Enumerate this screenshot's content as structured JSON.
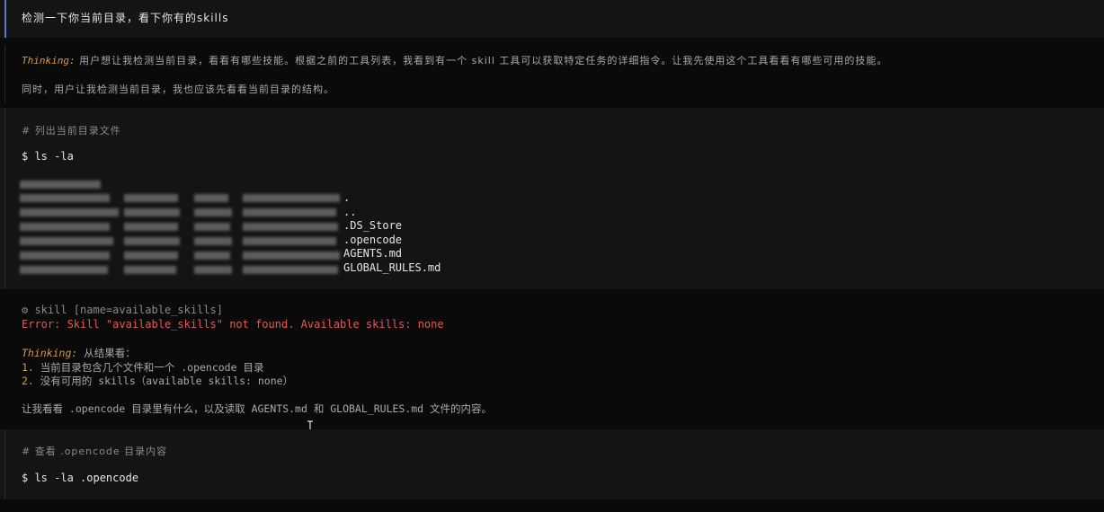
{
  "user_message": "检测一下你当前目录，看下你有的skills",
  "thinking_1": {
    "label": "Thinking:",
    "line1": "用户想让我检测当前目录，看看有哪些技能。根据之前的工具列表，我看到有一个 skill 工具可以获取特定任务的详细指令。让我先使用这个工具看看有哪些可用的技能。",
    "line2": "同时，用户让我检测当前目录，我也应该先看看当前目录的结构。"
  },
  "command_1": {
    "comment": "# 列出当前目录文件",
    "prompt": "$ ls -la",
    "files": [
      ".",
      "..",
      ".DS_Store",
      ".opencode",
      "AGENTS.md",
      "GLOBAL_RULES.md"
    ]
  },
  "tool_call": {
    "line": "⚙ skill [name=available_skills]",
    "error": "Error: Skill \"available_skills\" not found. Available skills: none"
  },
  "thinking_2": {
    "label": "Thinking:",
    "intro": "从结果看：",
    "item1_num": "1.",
    "item1": "当前目录包含几个文件和一个 .opencode 目录",
    "item2_num": "2.",
    "item2": "没有可用的 skills（available skills: none）",
    "conclusion": "让我看看 .opencode 目录里有什么，以及读取 AGENTS.md 和 GLOBAL_RULES.md 文件的内容。"
  },
  "command_2": {
    "comment": "# 查看 .opencode 目录内容",
    "prompt": "$ ls -la .opencode"
  },
  "colors": {
    "accent_blue": "#5a7cc8",
    "thinking_label": "#d49a3a",
    "error": "#e05a5a"
  }
}
